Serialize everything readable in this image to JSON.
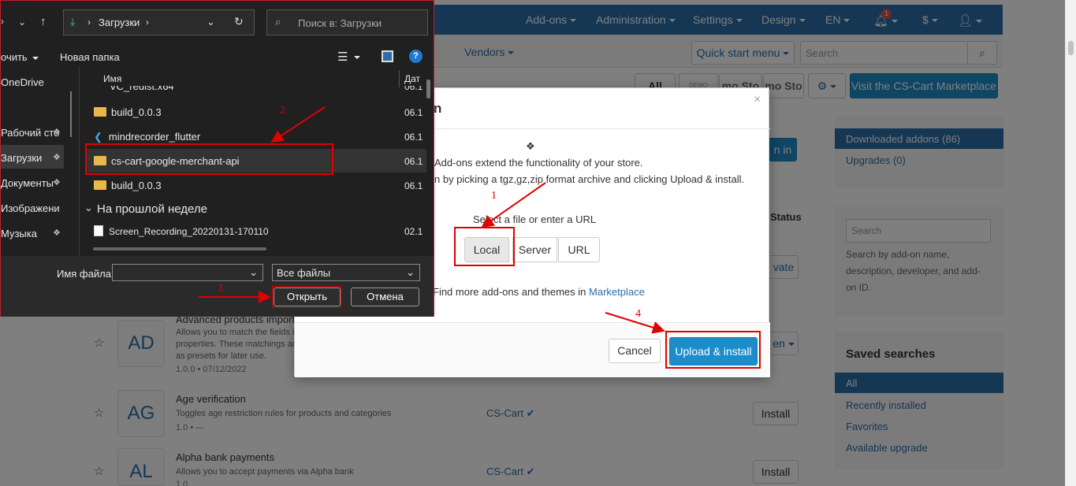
{
  "admin": {
    "topnav": [
      "Add-ons",
      "Administration",
      "Settings",
      "Design",
      "EN",
      "$"
    ],
    "notif_count": "1",
    "vendors": "Vendors",
    "quick_start": "Quick start menu",
    "search_placeholder": "Search",
    "filter_all": "All",
    "filter_demo": "DEMO",
    "filter_promo1": "mo Sto",
    "filter_promo2": "mo Sto",
    "marketplace_btn": "Visit the CS-Cart Marketplace",
    "partial_btn": "n in",
    "status_header": "Status",
    "activate_partial": "vate",
    "en_partial": "en",
    "sidebar": {
      "downloaded": "Downloaded addons (86)",
      "upgrades": "Upgrades (0)",
      "search_placeholder": "Search",
      "search_hint": [
        "Search by add-on name,",
        "description, developer, and add-",
        "on ID."
      ],
      "saved_title": "Saved searches",
      "saved": [
        "All",
        "Recently installed",
        "Favorites",
        "Available upgrade"
      ]
    },
    "rows": [
      {
        "abbr": "AD",
        "title": "Advanced products import",
        "desc": [
          "Allows you to match the fields in",
          "properties. These matchings and",
          "as presets for later use."
        ],
        "meta": "1.0.0 • 07/12/2022"
      },
      {
        "abbr": "AG",
        "title": "Age verification",
        "desc": [
          "Toggles age restriction rules for products and categories"
        ],
        "meta": "1.0 • —",
        "dev": "CS-Cart",
        "action": "Install"
      },
      {
        "abbr": "AL",
        "title": "Alpha bank payments",
        "desc": [
          "Allows you to accept payments via Alpha bank"
        ],
        "meta": "1.0",
        "dev": "CS-Cart",
        "action": "Install"
      }
    ]
  },
  "modal": {
    "title_partial": "n",
    "close": "×",
    "line1": "Add-ons extend the functionality of your store.",
    "line2": "n by picking a tgz,gz,zip format archive and clicking Upload & install.",
    "select_label": "Select a file or enter a URL",
    "tabs": [
      "Local",
      "Server",
      "URL"
    ],
    "find_more": "Find more add-ons and themes in",
    "marketplace_link": "Marketplace",
    "cancel": "Cancel",
    "upload": "Upload & install"
  },
  "file_dialog": {
    "breadcrumb": "Загрузки",
    "search_placeholder": "Поиск в: Загрузки",
    "organize": "очить",
    "new_folder": "Новая папка",
    "col_name": "Имя",
    "col_date": "Дат",
    "nav": [
      "OneDrive",
      "Рабочий сто",
      "Загрузки",
      "Документы",
      "Изображени",
      "Музыка"
    ],
    "files": [
      {
        "name": "VC_redist.x64",
        "date": "06.1"
      },
      {
        "name": "build_0.0.3",
        "date": "06.1"
      },
      {
        "name": "mindrecorder_flutter",
        "date": "06.1"
      },
      {
        "name": "cs-cart-google-merchant-api",
        "date": "06.1"
      },
      {
        "name": "build_0.0.3",
        "date": "06.1"
      }
    ],
    "group_label": "На прошлой неделе",
    "recording": {
      "name": "Screen_Recording_20220131-170110",
      "date": "02.1"
    },
    "filename_label": "Имя файла:",
    "filetype": "Все файлы",
    "open": "Открыть",
    "cancel": "Отмена"
  },
  "annotations": [
    "1",
    "2",
    "3",
    "4"
  ],
  "colors": {
    "brand": "#2b6ea9",
    "primary_button": "#1c8dc9",
    "highlight": "#e00000"
  }
}
